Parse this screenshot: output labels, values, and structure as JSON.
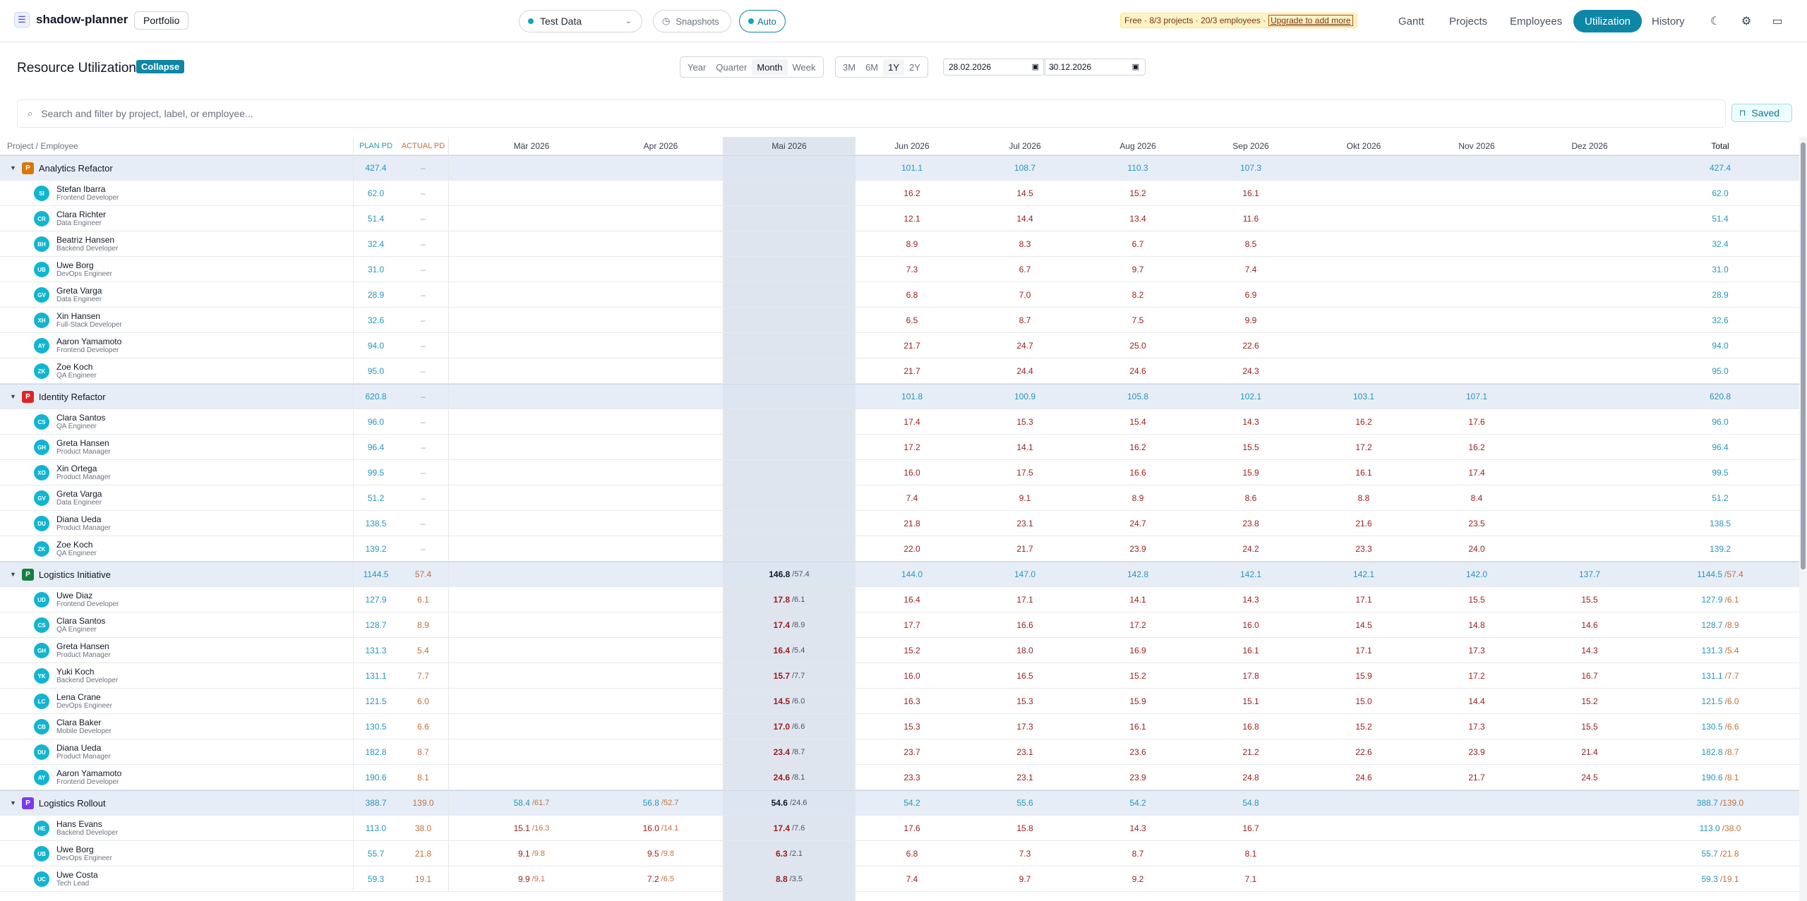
{
  "app": {
    "name": "shadow-planner",
    "portfolio": "Portfolio",
    "dataset": "Test Data",
    "snapshots": "Snapshots",
    "auto": "Auto",
    "plan_info": "Free · 8/3 projects · 20/3 employees ·",
    "upgrade": "Upgrade to add more"
  },
  "nav": [
    "Gantt",
    "Projects",
    "Employees",
    "Utilization",
    "History"
  ],
  "page": {
    "title": "Resource Utilization",
    "collapse": "Collapse",
    "granularity": [
      "Year",
      "Quarter",
      "Month",
      "Week"
    ],
    "ranges": [
      "3M",
      "6M",
      "1Y",
      "2Y"
    ],
    "date_from": "28.02.2026",
    "date_to": "30.12.2026",
    "range_sep": "→",
    "search_placeholder": "Search and filter by project, label, or employee...",
    "saved": "Saved"
  },
  "header": {
    "name": "Project / Employee",
    "plan": "PLAN PD",
    "actual": "ACTUAL PD",
    "total": "Total",
    "months": [
      "Mär 2026",
      "Apr 2026",
      "Mai 2026",
      "Jun 2026",
      "Jul 2026",
      "Aug 2026",
      "Sep 2026",
      "Okt 2026",
      "Nov 2026",
      "Dez 2026"
    ]
  },
  "colors": {
    "accent": "#0e86a6",
    "plan": "#2596be",
    "actual": "#c2703d",
    "value": "#9b1c1c"
  },
  "projects": [
    {
      "name": "Analytics Refactor",
      "badge": "P",
      "color": "#d97706",
      "plan": "427.4",
      "actual": "–",
      "months": [
        "",
        "",
        "",
        "101.1",
        "108.7",
        "110.3",
        "107.3",
        "",
        "",
        ""
      ],
      "total": "427.4",
      "employees": [
        {
          "initials": "SI",
          "name": "Stefan Ibarra",
          "role": "Frontend Developer",
          "plan": "62.0",
          "actual": "–",
          "months": [
            "",
            "",
            "",
            "16.2",
            "14.5",
            "15.2",
            "16.1",
            "",
            "",
            ""
          ],
          "total": "62.0"
        },
        {
          "initials": "CR",
          "name": "Clara Richter",
          "role": "Data Engineer",
          "plan": "51.4",
          "actual": "–",
          "months": [
            "",
            "",
            "",
            "12.1",
            "14.4",
            "13.4",
            "11.6",
            "",
            "",
            ""
          ],
          "total": "51.4"
        },
        {
          "initials": "BH",
          "name": "Beatriz Hansen",
          "role": "Backend Developer",
          "plan": "32.4",
          "actual": "–",
          "months": [
            "",
            "",
            "",
            "8.9",
            "8.3",
            "6.7",
            "8.5",
            "",
            "",
            ""
          ],
          "total": "32.4"
        },
        {
          "initials": "UB",
          "name": "Uwe Borg",
          "role": "DevOps Engineer",
          "plan": "31.0",
          "actual": "–",
          "months": [
            "",
            "",
            "",
            "7.3",
            "6.7",
            "9.7",
            "7.4",
            "",
            "",
            ""
          ],
          "total": "31.0"
        },
        {
          "initials": "GV",
          "name": "Greta Varga",
          "role": "Data Engineer",
          "plan": "28.9",
          "actual": "–",
          "months": [
            "",
            "",
            "",
            "6.8",
            "7.0",
            "8.2",
            "6.9",
            "",
            "",
            ""
          ],
          "total": "28.9"
        },
        {
          "initials": "XH",
          "name": "Xin Hansen",
          "role": "Full-Stack Developer",
          "plan": "32.6",
          "actual": "–",
          "months": [
            "",
            "",
            "",
            "6.5",
            "8.7",
            "7.5",
            "9.9",
            "",
            "",
            ""
          ],
          "total": "32.6"
        },
        {
          "initials": "AY",
          "name": "Aaron Yamamoto",
          "role": "Frontend Developer",
          "plan": "94.0",
          "actual": "–",
          "months": [
            "",
            "",
            "",
            "21.7",
            "24.7",
            "25.0",
            "22.6",
            "",
            "",
            ""
          ],
          "total": "94.0"
        },
        {
          "initials": "ZK",
          "name": "Zoe Koch",
          "role": "QA Engineer",
          "plan": "95.0",
          "actual": "–",
          "months": [
            "",
            "",
            "",
            "21.7",
            "24.4",
            "24.6",
            "24.3",
            "",
            "",
            ""
          ],
          "total": "95.0"
        }
      ]
    },
    {
      "name": "Identity Refactor",
      "badge": "P",
      "color": "#dc2626",
      "plan": "620.8",
      "actual": "–",
      "months": [
        "",
        "",
        "",
        "101.8",
        "100.9",
        "105.8",
        "102.1",
        "103.1",
        "107.1",
        ""
      ],
      "total": "620.8",
      "employees": [
        {
          "initials": "CS",
          "name": "Clara Santos",
          "role": "QA Engineer",
          "plan": "96.0",
          "actual": "–",
          "months": [
            "",
            "",
            "",
            "17.4",
            "15.3",
            "15.4",
            "14.3",
            "16.2",
            "17.6",
            ""
          ],
          "total": "96.0"
        },
        {
          "initials": "GH",
          "name": "Greta Hansen",
          "role": "Product Manager",
          "plan": "96.4",
          "actual": "–",
          "months": [
            "",
            "",
            "",
            "17.2",
            "14.1",
            "16.2",
            "15.5",
            "17.2",
            "16.2",
            ""
          ],
          "total": "96.4"
        },
        {
          "initials": "XO",
          "name": "Xin Ortega",
          "role": "Product Manager",
          "plan": "99.5",
          "actual": "–",
          "months": [
            "",
            "",
            "",
            "16.0",
            "17.5",
            "16.6",
            "15.9",
            "16.1",
            "17.4",
            ""
          ],
          "total": "99.5"
        },
        {
          "initials": "GV",
          "name": "Greta Varga",
          "role": "Data Engineer",
          "plan": "51.2",
          "actual": "–",
          "months": [
            "",
            "",
            "",
            "7.4",
            "9.1",
            "8.9",
            "8.6",
            "8.8",
            "8.4",
            ""
          ],
          "total": "51.2"
        },
        {
          "initials": "DU",
          "name": "Diana Ueda",
          "role": "Product Manager",
          "plan": "138.5",
          "actual": "–",
          "months": [
            "",
            "",
            "",
            "21.8",
            "23.1",
            "24.7",
            "23.8",
            "21.6",
            "23.5",
            ""
          ],
          "total": "138.5"
        },
        {
          "initials": "ZK",
          "name": "Zoe Koch",
          "role": "QA Engineer",
          "plan": "139.2",
          "actual": "–",
          "months": [
            "",
            "",
            "",
            "22.0",
            "21.7",
            "23.9",
            "24.2",
            "23.3",
            "24.0",
            ""
          ],
          "total": "139.2"
        }
      ]
    },
    {
      "name": "Logistics Initiative",
      "badge": "P",
      "color": "#15803d",
      "plan": "1144.5",
      "actual": "57.4",
      "months": [
        "",
        "",
        "146.8 /57.4",
        "144.0",
        "147.0",
        "142.8",
        "142.1",
        "142.1",
        "142.0",
        "137.7"
      ],
      "total": "1144.5",
      "total_actual": "/57.4",
      "employees": [
        {
          "initials": "UD",
          "name": "Uwe Diaz",
          "role": "Frontend Developer",
          "plan": "127.9",
          "actual": "6.1",
          "months": [
            "",
            "",
            "17.8 /6.1",
            "16.4",
            "17.1",
            "14.1",
            "14.3",
            "17.1",
            "15.5",
            "15.5"
          ],
          "total": "127.9",
          "total_actual": "/6.1"
        },
        {
          "initials": "CS",
          "name": "Clara Santos",
          "role": "QA Engineer",
          "plan": "128.7",
          "actual": "8.9",
          "months": [
            "",
            "",
            "17.4 /8.9",
            "17.7",
            "16.6",
            "17.2",
            "16.0",
            "14.5",
            "14.8",
            "14.6"
          ],
          "total": "128.7",
          "total_actual": "/8.9"
        },
        {
          "initials": "GH",
          "name": "Greta Hansen",
          "role": "Product Manager",
          "plan": "131.3",
          "actual": "5.4",
          "months": [
            "",
            "",
            "16.4 /5.4",
            "15.2",
            "18.0",
            "16.9",
            "16.1",
            "17.1",
            "17.3",
            "14.3"
          ],
          "total": "131.3",
          "total_actual": "/5.4"
        },
        {
          "initials": "YK",
          "name": "Yuki Koch",
          "role": "Backend Developer",
          "plan": "131.1",
          "actual": "7.7",
          "months": [
            "",
            "",
            "15.7 /7.7",
            "16.0",
            "16.5",
            "15.2",
            "17.8",
            "15.9",
            "17.2",
            "16.7"
          ],
          "total": "131.1",
          "total_actual": "/7.7"
        },
        {
          "initials": "LC",
          "name": "Lena Crane",
          "role": "DevOps Engineer",
          "plan": "121.5",
          "actual": "6.0",
          "months": [
            "",
            "",
            "14.5 /6.0",
            "16.3",
            "15.3",
            "15.9",
            "15.1",
            "15.0",
            "14.4",
            "15.2"
          ],
          "total": "121.5",
          "total_actual": "/6.0"
        },
        {
          "initials": "CB",
          "name": "Clara Baker",
          "role": "Mobile Developer",
          "plan": "130.5",
          "actual": "6.6",
          "months": [
            "",
            "",
            "17.0 /6.6",
            "15.3",
            "17.3",
            "16.1",
            "16.8",
            "15.2",
            "17.3",
            "15.5"
          ],
          "total": "130.5",
          "total_actual": "/6.6"
        },
        {
          "initials": "DU",
          "name": "Diana Ueda",
          "role": "Product Manager",
          "plan": "182.8",
          "actual": "8.7",
          "months": [
            "",
            "",
            "23.4 /8.7",
            "23.7",
            "23.1",
            "23.6",
            "21.2",
            "22.6",
            "23.9",
            "21.4"
          ],
          "total": "182.8",
          "total_actual": "/8.7"
        },
        {
          "initials": "AY",
          "name": "Aaron Yamamoto",
          "role": "Frontend Developer",
          "plan": "190.6",
          "actual": "8.1",
          "months": [
            "",
            "",
            "24.6 /8.1",
            "23.3",
            "23.1",
            "23.9",
            "24.8",
            "24.6",
            "21.7",
            "24.5"
          ],
          "total": "190.6",
          "total_actual": "/8.1"
        }
      ]
    },
    {
      "name": "Logistics Rollout",
      "badge": "P",
      "color": "#7c3aed",
      "plan": "388.7",
      "actual": "139.0",
      "months": [
        "58.4 /61.7",
        "56.8 /52.7",
        "54.6 /24.6",
        "54.2",
        "55.6",
        "54.2",
        "54.8",
        "",
        "",
        ""
      ],
      "total": "388.7",
      "total_actual": "/139.0",
      "employees": [
        {
          "initials": "HE",
          "name": "Hans Evans",
          "role": "Backend Developer",
          "plan": "113.0",
          "actual": "38.0",
          "months": [
            "15.1 /16.3",
            "16.0 /14.1",
            "17.4 /7.6",
            "17.6",
            "15.8",
            "14.3",
            "16.7",
            "",
            "",
            ""
          ],
          "total": "113.0",
          "total_actual": "/38.0"
        },
        {
          "initials": "UB",
          "name": "Uwe Borg",
          "role": "DevOps Engineer",
          "plan": "55.7",
          "actual": "21.8",
          "months": [
            "9.1 /9.8",
            "9.5 /9.8",
            "6.3 /2.1",
            "6.8",
            "7.3",
            "8.7",
            "8.1",
            "",
            "",
            ""
          ],
          "total": "55.7",
          "total_actual": "/21.8"
        },
        {
          "initials": "UC",
          "name": "Uwe Costa",
          "role": "Tech Lead",
          "plan": "59.3",
          "actual": "19.1",
          "months": [
            "9.9 /9.1",
            "7.2 /6.5",
            "8.8 /3.5",
            "7.4",
            "9.7",
            "9.2",
            "7.1",
            "",
            "",
            ""
          ],
          "total": "59.3",
          "total_actual": "/19.1"
        }
      ]
    }
  ]
}
